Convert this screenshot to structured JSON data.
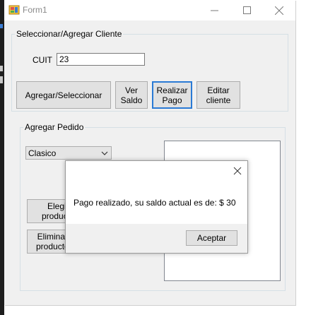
{
  "window": {
    "title": "Form1",
    "controls": [
      "minimize-icon",
      "maximize-icon",
      "close-icon"
    ]
  },
  "cliente_group": {
    "legend": "Seleccionar/Agregar Cliente",
    "cuit_label": "CUIT",
    "cuit_value": "23",
    "buttons": {
      "agregar": "Agregar/Seleccionar",
      "ver_saldo": "Ver\nSaldo",
      "realizar_pago": "Realizar\nPago",
      "editar_cliente": "Editar\ncliente"
    }
  },
  "pedido_group": {
    "legend": "Agregar Pedido",
    "combo_value": "Clasico",
    "elegir_label": "Elegir\nproducto",
    "eliminar_label": "Eliminar\nproducto"
  },
  "message_box": {
    "text": "Pago realizado, su saldo actual es de: $ 30",
    "ok_label": "Aceptar"
  },
  "colors": {
    "accent_focus": "#2a7ad5",
    "form_bg": "#f0f0f0",
    "button_bg": "#e1e1e1"
  }
}
